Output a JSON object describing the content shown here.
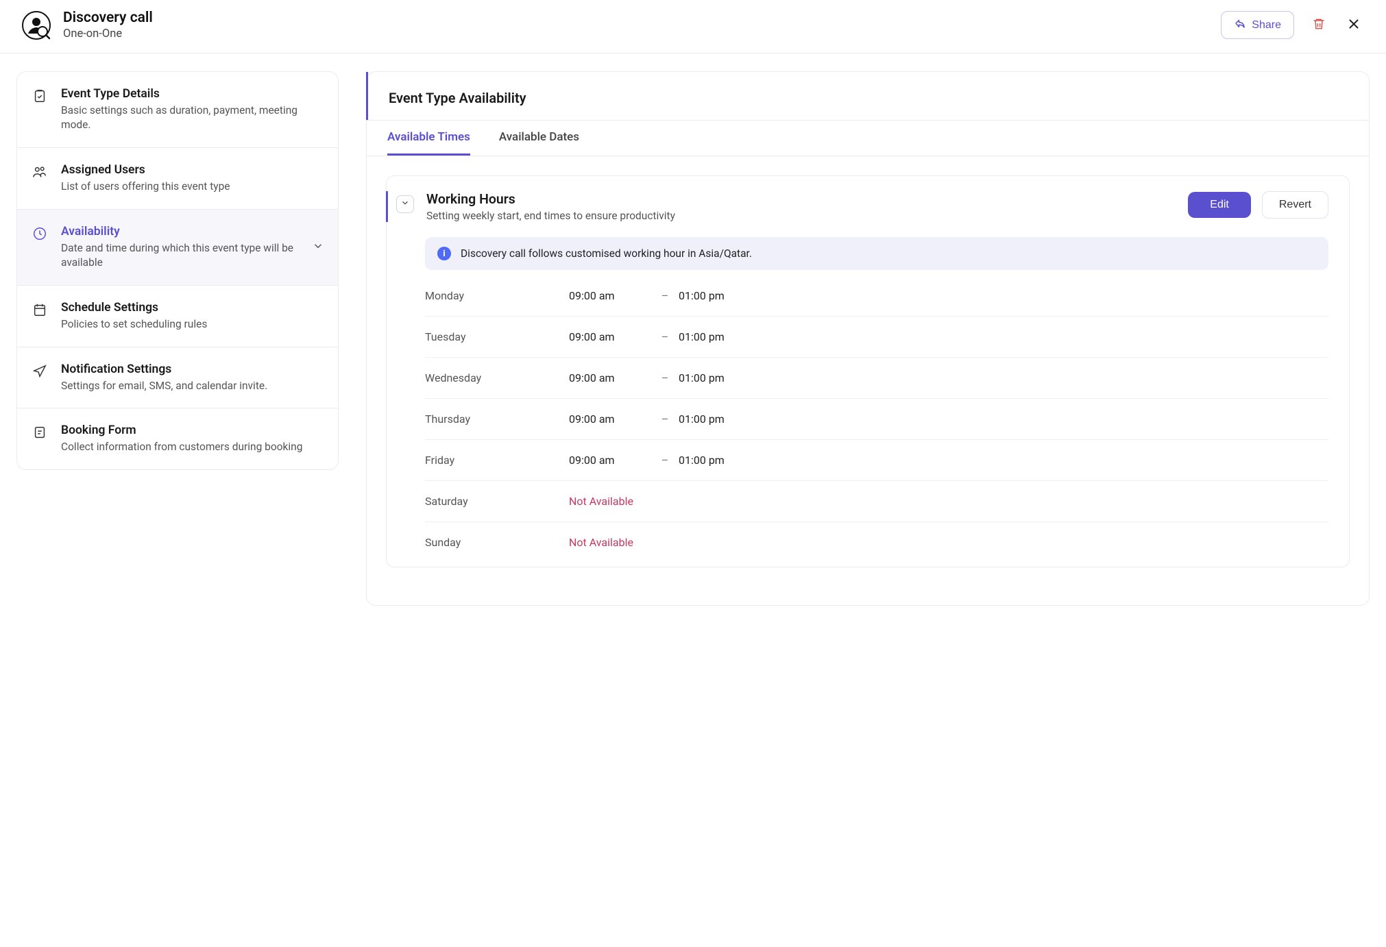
{
  "header": {
    "title": "Discovery call",
    "subtitle": "One-on-One",
    "share_label": "Share"
  },
  "sidebar": {
    "items": [
      {
        "title": "Event Type Details",
        "desc": "Basic settings such as duration, payment, meeting mode."
      },
      {
        "title": "Assigned Users",
        "desc": "List of users offering this event type"
      },
      {
        "title": "Availability",
        "desc": "Date and time during which this event type will be available"
      },
      {
        "title": "Schedule Settings",
        "desc": "Policies to set scheduling rules"
      },
      {
        "title": "Notification Settings",
        "desc": "Settings for email, SMS, and calendar invite."
      },
      {
        "title": "Booking Form",
        "desc": "Collect information from customers during booking"
      }
    ]
  },
  "content": {
    "heading": "Event Type Availability",
    "tabs": {
      "times": "Available Times",
      "dates": "Available Dates"
    },
    "section": {
      "title": "Working Hours",
      "subtitle": "Setting weekly start, end times to ensure productivity",
      "edit": "Edit",
      "revert": "Revert",
      "info": "Discovery call follows customised working hour in Asia/Qatar.",
      "not_available": "Not Available",
      "hours": [
        {
          "day": "Monday",
          "start": "09:00 am",
          "end": "01:00 pm"
        },
        {
          "day": "Tuesday",
          "start": "09:00 am",
          "end": "01:00 pm"
        },
        {
          "day": "Wednesday",
          "start": "09:00 am",
          "end": "01:00 pm"
        },
        {
          "day": "Thursday",
          "start": "09:00 am",
          "end": "01:00 pm"
        },
        {
          "day": "Friday",
          "start": "09:00 am",
          "end": "01:00 pm"
        },
        {
          "day": "Saturday",
          "na": true
        },
        {
          "day": "Sunday",
          "na": true
        }
      ]
    }
  }
}
